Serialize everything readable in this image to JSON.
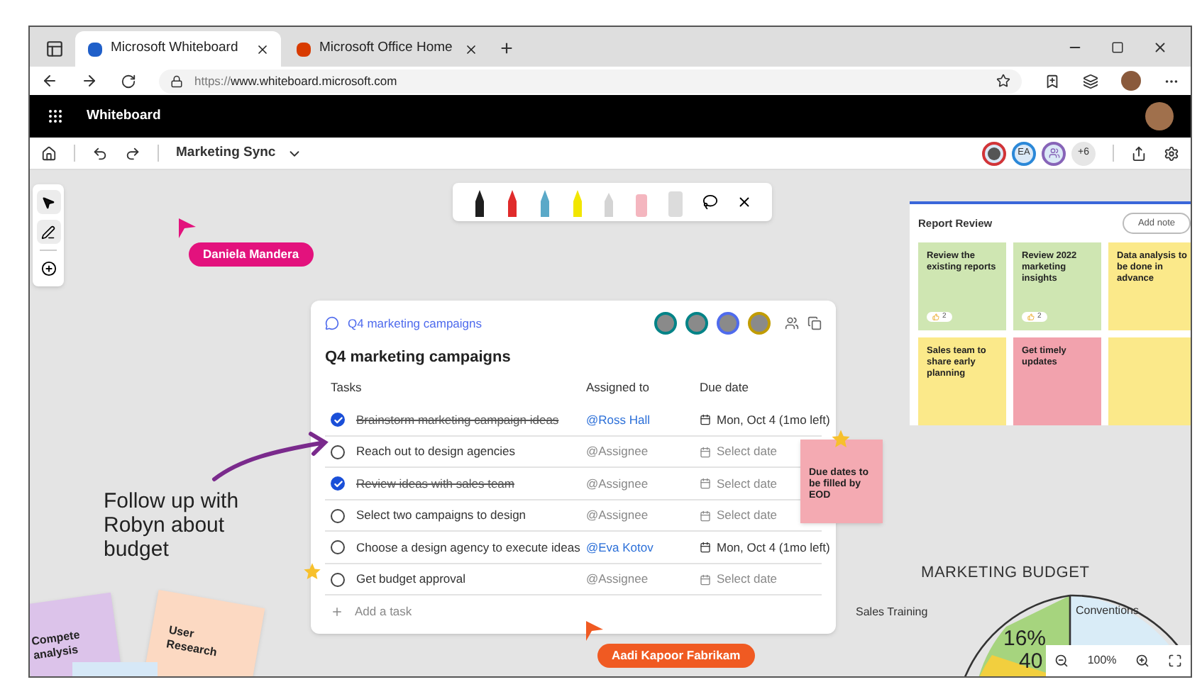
{
  "browser": {
    "tabs": [
      {
        "label": "Microsoft Whiteboard",
        "selected": true
      },
      {
        "label": "Microsoft Office Home",
        "selected": false
      }
    ],
    "new_tab": "+",
    "url_prefix": "https://",
    "url": "www.whiteboard.microsoft.com"
  },
  "app": {
    "title": "Whiteboard"
  },
  "toolbar": {
    "board_name": "Marketing Sync",
    "collaborators": [
      {
        "kind": "photo",
        "color": "#d13438"
      },
      {
        "kind": "initials",
        "initials": "EA",
        "color": "#2b88d8"
      },
      {
        "kind": "icon",
        "color": "#8764b8"
      }
    ],
    "more_count": "+6"
  },
  "pen_tray": {
    "pens": [
      {
        "color": "#1f1f1f"
      },
      {
        "color": "#e02b2b"
      },
      {
        "color": "#5aa9c8"
      },
      {
        "color": "#f2e600"
      }
    ]
  },
  "cursors": [
    {
      "name": "Daniela Mandera",
      "color": "#e3127d"
    },
    {
      "name": "Aadi Kapoor Fabrikam",
      "color": "#f05a22"
    }
  ],
  "loop_card": {
    "link": "Q4 marketing campaigns",
    "title": "Q4 marketing campaigns",
    "avatars": [
      {
        "color": "#038387"
      },
      {
        "color": "#038387"
      },
      {
        "color": "#4f6bed"
      },
      {
        "color": "#c19c00"
      }
    ],
    "columns": [
      "Tasks",
      "Assigned to",
      "Due date"
    ],
    "rows": [
      {
        "task": "Brainstorm marketing campaign ideas",
        "checked": true,
        "assignee": "@Ross Hall",
        "assigned": true,
        "due": "Mon, Oct 4 (1mo left)",
        "date_set": true
      },
      {
        "task": "Reach out to design agencies",
        "checked": false,
        "assignee": "@Assignee",
        "assigned": false,
        "due": "Select date",
        "date_set": false
      },
      {
        "task": "Review ideas with sales team",
        "checked": true,
        "assignee": "@Assignee",
        "assigned": false,
        "due": "Select date",
        "date_set": false
      },
      {
        "task": "Select two campaigns to design",
        "checked": false,
        "assignee": "@Assignee",
        "assigned": false,
        "due": "Select date",
        "date_set": false
      },
      {
        "task": "Choose a design agency to execute ideas",
        "checked": false,
        "assignee": "@Eva Kotov",
        "assigned": true,
        "due": "Mon, Oct 4 (1mo left)",
        "date_set": true
      },
      {
        "task": "Get budget approval",
        "checked": false,
        "assignee": "@Assignee",
        "assigned": false,
        "due": "Select date",
        "date_set": false
      }
    ],
    "add_task": "Add a task"
  },
  "handwriting": "Follow up with Robyn about budget",
  "sticky_notes": [
    {
      "text": "Due dates to be filled by EOD",
      "color": "#f4aab2"
    },
    {
      "text": "Compete analysis",
      "color": "#dcc3ea"
    },
    {
      "text": "User Research",
      "color": "#fcd9c2"
    }
  ],
  "report_review": {
    "title": "Report Review",
    "button": "Add note",
    "notes": [
      {
        "text": "Review the existing reports",
        "color": "#cfe6b2",
        "reactions": "2"
      },
      {
        "text": "Review 2022 marketing insights",
        "color": "#cfe6b2",
        "reactions": "2"
      },
      {
        "text": "Data analysis to be done in advance",
        "color": "#fbe98a"
      },
      {
        "text": "Sales team to share early planning",
        "color": "#fbe98a"
      },
      {
        "text": "Get timely updates",
        "color": "#f2a2ad"
      },
      {
        "color": "#fbe98a"
      }
    ]
  },
  "budget": {
    "title": "MARKETING BUDGET",
    "labels": [
      "Sales Training",
      "Conventions"
    ],
    "slices": [
      "16%",
      "40"
    ]
  },
  "zoom": {
    "level": "100%"
  }
}
